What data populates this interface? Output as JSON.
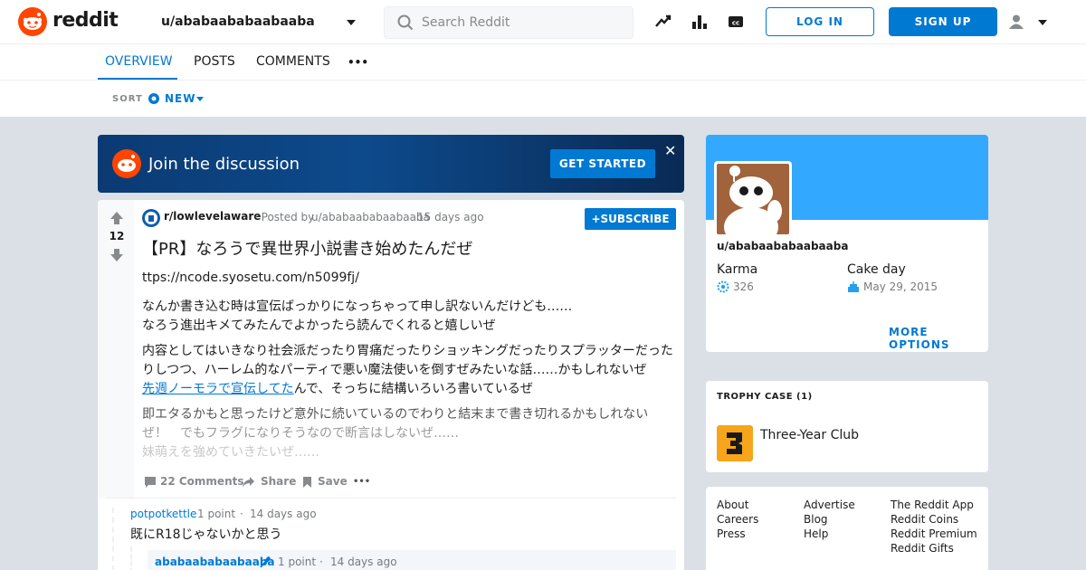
{
  "header": {
    "logo_text": "reddit",
    "user_dropdown": "u/ababaababaabaaba",
    "search_placeholder": "Search Reddit",
    "login_label": "LOG IN",
    "signup_label": "SIGN UP"
  },
  "tabs": [
    "OVERVIEW",
    "POSTS",
    "COMMENTS",
    "•••"
  ],
  "sort": {
    "label": "SORT",
    "value": "NEW"
  },
  "banner": {
    "title": "Join the discussion",
    "button": "GET STARTED",
    "close": "✕"
  },
  "post": {
    "score": "12",
    "subreddit": "r/lowlevelaware",
    "posted_by_prefix": "· Posted by",
    "author": "u/ababaababaabaaba",
    "time": "15 days ago",
    "subscribe_label": "SUBSCRIBE",
    "title": "【PR】なろうで異世界小説書き始めたんだぜ",
    "lines": [
      "ttps://ncode.syosetu.com/n5099fj/",
      "なんか書き込む時は宣伝ばっかりになっちゃって申し訳ないんだけども……",
      "なろう進出キメてみたんでよかったら読んでくれると嬉しいぜ",
      "内容としてはいきなり社会派だったり胃痛だったりショッキングだったりスプラッターだった",
      "りしつつ、ハーレム的なパーティで悪い魔法使いを倒すぜみたいな話……かもしれないぜ",
      "んで、そっちに結構いろいろ書いているぜ",
      "即エタるかもと思ったけど意外に続いているのでわりと結末まで書き切れるかもしれない",
      "ぜ！　でもフラグになりそうなので断言はしないぜ……",
      "妹萌えを強めていきたいぜ……"
    ],
    "link_text": "先週ノーモラで宣伝してた",
    "comments_label": "22 Comments",
    "share_label": "Share",
    "save_label": "Save",
    "more_label": "•••"
  },
  "comments": [
    {
      "author": "potpotkettle",
      "points": "1 point",
      "dot": "·",
      "time": "14 days ago",
      "text": "既にR18じゃないかと思う"
    },
    {
      "author": "ababaababaabaaba",
      "points": "1 point",
      "dot": "·",
      "time": "14 days ago",
      "text": ""
    }
  ],
  "sidebar": {
    "username": "u/ababaababaabaaba",
    "karma_label": "Karma",
    "karma_value": "326",
    "cakeday_label": "Cake day",
    "cakeday_value": "May 29, 2015",
    "more_options": "MORE OPTIONS",
    "trophy_header": "TROPHY CASE (1)",
    "trophy_name": "Three-Year Club",
    "footer_links": [
      [
        "About",
        "Careers",
        "Press"
      ],
      [
        "Advertise",
        "Blog",
        "Help"
      ],
      [
        "The Reddit App",
        "Reddit Coins",
        "Reddit Premium",
        "Reddit Gifts"
      ]
    ]
  },
  "colors": {
    "accent": "#0079d3",
    "brand": "#ff4500",
    "page_bg": "#dae0e6"
  }
}
